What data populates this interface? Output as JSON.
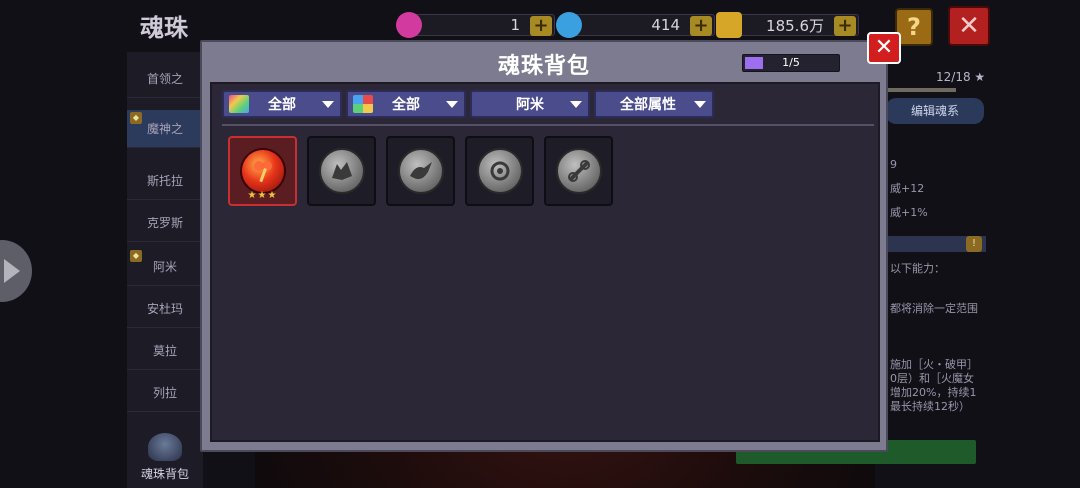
{
  "background": {
    "title": "魂珠",
    "resources": [
      {
        "name": "pink-gem",
        "value": "1",
        "color": "#d23aa0"
      },
      {
        "name": "blue-gem",
        "value": "414",
        "color": "#3aa0e0"
      },
      {
        "name": "gold-coin",
        "value": "185.6万",
        "color": "#d6a629"
      }
    ],
    "help_label": "?",
    "close_label": "✕",
    "sidebar": {
      "items": [
        "首领之",
        "魔神之",
        "斯托拉",
        "克罗斯",
        "阿米",
        "安杜玛",
        "莫拉",
        "列拉"
      ],
      "bag_label": "魂珠背包"
    },
    "right_panel": {
      "count": "12/18 ★",
      "edit_button": "编辑魂系",
      "lines": [
        "9",
        "威+12",
        "威+1%",
        "以下能力：",
        "都将消除一定范围",
        "施加［火・破甲］",
        "0层）和［火魔女",
        "增加20%，持续1",
        "最长持续12秒）"
      ]
    }
  },
  "modal": {
    "title": "魂珠背包",
    "capacity": {
      "label": "1/5",
      "fraction": 0.2
    },
    "close_label": "✕",
    "filters": [
      {
        "label": "全部",
        "icon": "rainbow-icon"
      },
      {
        "label": "全部",
        "icon": "color-grid-icon"
      },
      {
        "label": "阿米",
        "icon": null
      },
      {
        "label": "全部属性",
        "icon": null
      }
    ],
    "items": [
      {
        "name": "fire-orb",
        "selected": true,
        "stars": "★★★"
      },
      {
        "name": "wolf-orb",
        "selected": false,
        "stars": ""
      },
      {
        "name": "dragon-orb",
        "selected": false,
        "stars": ""
      },
      {
        "name": "rune-orb",
        "selected": false,
        "stars": ""
      },
      {
        "name": "chain-orb",
        "selected": false,
        "stars": ""
      }
    ]
  },
  "colors": {
    "accent": "#9d6ff0",
    "filter_bg": "#4b4c8c",
    "close_red": "#d21e1e"
  }
}
